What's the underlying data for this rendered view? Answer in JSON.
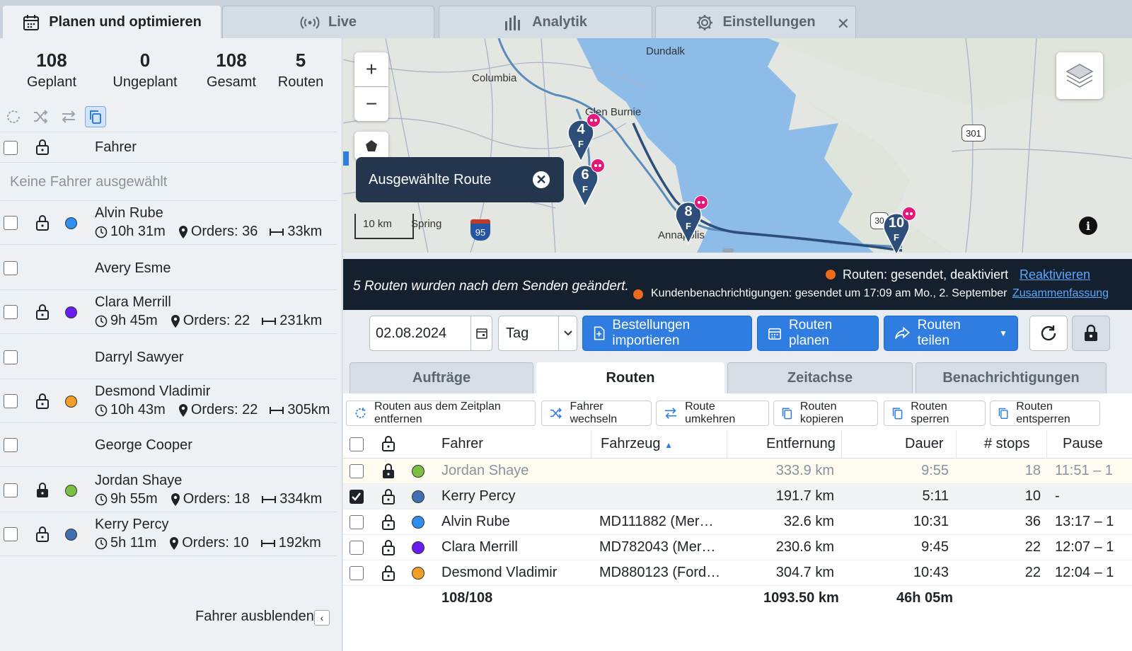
{
  "top_tabs": [
    {
      "label": "Planen und optimieren",
      "icon": "calendar-icon"
    },
    {
      "label": "Live",
      "icon": "broadcast-icon"
    },
    {
      "label": "Analytik",
      "icon": "bar-chart-icon"
    },
    {
      "label": "Einstellungen",
      "icon": "gear-icon"
    }
  ],
  "stats": [
    {
      "value": "108",
      "label": "Geplant"
    },
    {
      "value": "0",
      "label": "Ungeplant"
    },
    {
      "value": "108",
      "label": "Gesamt"
    },
    {
      "value": "5",
      "label": "Routen"
    }
  ],
  "drivers_panel": {
    "header": "Fahrer",
    "no_selection": "Keine Fahrer ausgewählt",
    "hide_label": "Fahrer ausblenden",
    "drivers": [
      {
        "name": "Alvin Rube",
        "color": "#2f8ff0",
        "time": "10h 31m",
        "orders": "Orders: 36",
        "dist": "33km",
        "locked": false
      },
      {
        "name": "Avery Esme"
      },
      {
        "name": "Clara Merrill",
        "color": "#6a1cf0",
        "time": "9h 45m",
        "orders": "Orders: 22",
        "dist": "231km",
        "locked": false
      },
      {
        "name": "Darryl Sawyer"
      },
      {
        "name": "Desmond Vladimir",
        "color": "#f39c26",
        "time": "10h 43m",
        "orders": "Orders: 22",
        "dist": "305km",
        "locked": false
      },
      {
        "name": "George Cooper"
      },
      {
        "name": "Jordan Shaye",
        "color": "#7bc043",
        "time": "9h 55m",
        "orders": "Orders: 18",
        "dist": "334km",
        "locked": true
      },
      {
        "name": "Kerry Percy",
        "color": "#3f6fb0",
        "time": "5h 11m",
        "orders": "Orders: 10",
        "dist": "192km",
        "locked": false
      }
    ]
  },
  "map": {
    "labels": [
      "Dundalk",
      "Columbia",
      "Glen Burnie",
      "Annapolis",
      "Spring"
    ],
    "route_shields": [
      "301",
      "95",
      "30"
    ],
    "scale": "10 km",
    "popup": "Ausgewählte Route",
    "markers": [
      {
        "num": "4",
        "sub": "F"
      },
      {
        "num": "6",
        "sub": "F"
      },
      {
        "num": "8",
        "sub": "F"
      },
      {
        "num": "10",
        "sub": "F"
      }
    ]
  },
  "banner": {
    "message": "5 Routen wurden nach dem Senden geändert.",
    "status1": "Routen: gesendet, deaktiviert",
    "link1": "Reaktivieren",
    "status2": "Kundenbenachrichtigungen: gesendet um 17:09 am Mo., 2. September",
    "link2": "Zusammenfassung"
  },
  "controls": {
    "date": "02.08.2024",
    "period": "Tag",
    "import": "Bestellungen importieren",
    "plan": "Routen planen",
    "share": "Routen teilen"
  },
  "sub_tabs": [
    "Aufträge",
    "Routen",
    "Zeitachse",
    "Benachrichtigungen"
  ],
  "actions": [
    "Routen aus dem Zeitplan entfernen",
    "Fahrer wechseln",
    "Route umkehren",
    "Routen kopieren",
    "Routen sperren",
    "Routen entsperren"
  ],
  "table": {
    "columns": [
      "Fahrer",
      "Fahrzeug",
      "Entfernung",
      "Dauer",
      "# stops",
      "Pause"
    ],
    "rows": [
      {
        "driver": "Jordan Shaye",
        "color": "#7bc043",
        "vehicle": "",
        "distance": "333.9 km",
        "duration": "9:55",
        "stops": "18",
        "pause": "11:51 – 1",
        "locked": true,
        "checked": false
      },
      {
        "driver": "Kerry Percy",
        "color": "#3f6fb0",
        "vehicle": "",
        "distance": "191.7 km",
        "duration": "5:11",
        "stops": "10",
        "pause": "-",
        "locked": false,
        "checked": true
      },
      {
        "driver": "Alvin Rube",
        "color": "#2f8ff0",
        "vehicle": "MD111882 (Mer…",
        "distance": "32.6 km",
        "duration": "10:31",
        "stops": "36",
        "pause": "13:17 – 1",
        "locked": false,
        "checked": false
      },
      {
        "driver": "Clara Merrill",
        "color": "#6a1cf0",
        "vehicle": "MD782043 (Mer…",
        "distance": "230.6 km",
        "duration": "9:45",
        "stops": "22",
        "pause": "12:07 – 1",
        "locked": false,
        "checked": false
      },
      {
        "driver": "Desmond Vladimir",
        "color": "#f39c26",
        "vehicle": "MD880123 (Ford…",
        "distance": "304.7 km",
        "duration": "10:43",
        "stops": "22",
        "pause": "12:04 – 1",
        "locked": false,
        "checked": false
      }
    ],
    "totals": {
      "count": "108/108",
      "distance": "1093.50 km",
      "duration": "46h 05m"
    }
  }
}
